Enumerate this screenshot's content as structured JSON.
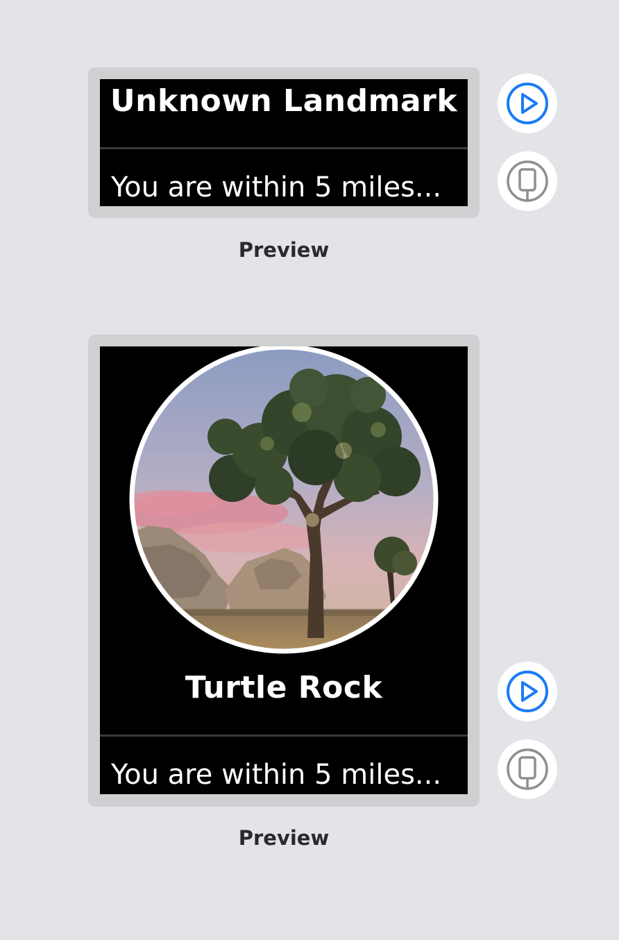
{
  "previews": [
    {
      "title": "Unknown Landmark",
      "message": "You are within 5 miles...",
      "label": "Preview"
    },
    {
      "title": "Turtle Rock",
      "message": "You are within 5 miles...",
      "label": "Preview",
      "image": "joshua-tree-landmark-photo"
    }
  ],
  "controls": {
    "live_icon": "play-circle-icon",
    "device_icon": "device-icon",
    "accent": "#1a7cf5",
    "inactive": "#8e8e93"
  }
}
